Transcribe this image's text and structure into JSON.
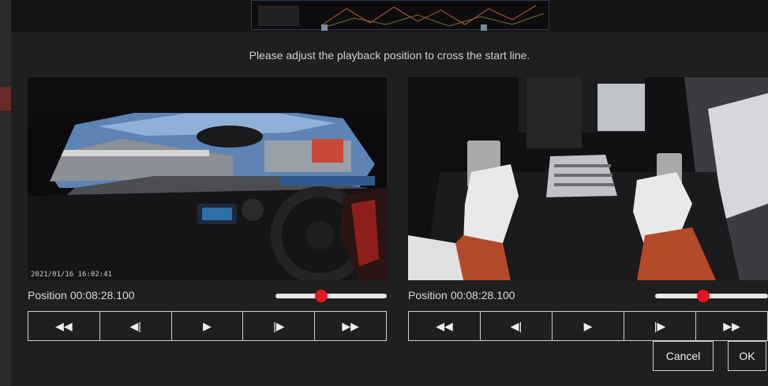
{
  "dialog": {
    "message": "Please adjust the playback position to cross the start line.",
    "cancel_label": "Cancel",
    "ok_label": "OK"
  },
  "left_player": {
    "timestamp_overlay": "2021/01/16 16:02:41",
    "position_label": "Position",
    "position_value": "00:08:28.100",
    "slider_fraction": 0.41
  },
  "right_player": {
    "position_label": "Position",
    "position_value": "00:08:28.100",
    "slider_fraction": 0.43
  },
  "controls": {
    "rewind_icon": "◀◀",
    "step_back_icon": "◀|",
    "play_icon": "▶",
    "step_forward_icon": "|▶",
    "fast_forward_icon": "▶▶"
  },
  "colors": {
    "knob": "#e8141e",
    "slider_track": "#e8e8e8",
    "dialog_bg": "#1f1f1f"
  }
}
